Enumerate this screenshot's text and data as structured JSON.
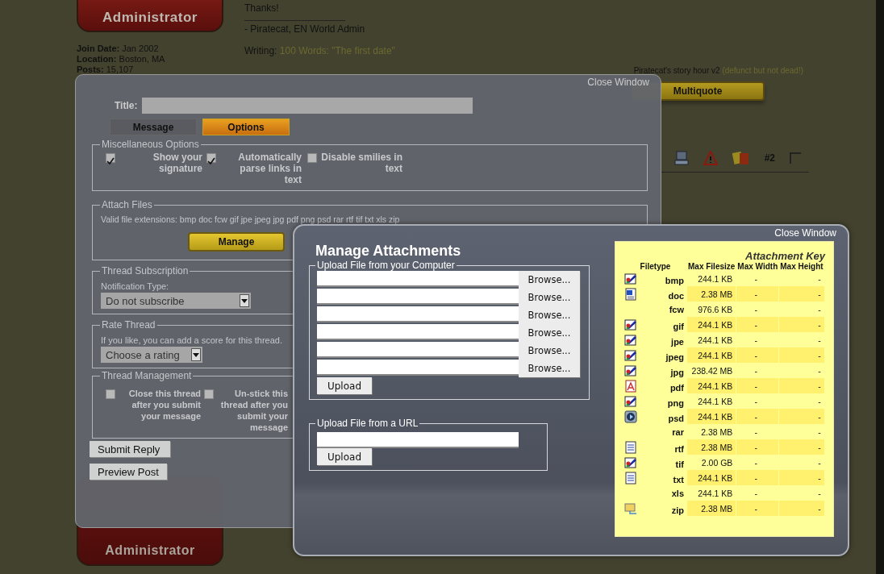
{
  "forum": {
    "top_post": {
      "rank_badge": "Administrator",
      "info": [
        {
          "label": "Join Date:",
          "value": "Jan 2002"
        },
        {
          "label": "Location:",
          "value": "Boston, MA"
        },
        {
          "label": "Posts:",
          "value": "15,107"
        }
      ],
      "message": "Thanks!",
      "signature": "- Piratecat, EN World Admin",
      "writing": {
        "label": "Writing:",
        "link": "100 Words: \"The first date\""
      },
      "story_link": "Piratecat's story hour v2",
      "story_note": "(defunct but not dead!)",
      "buttons": [
        "Multiquote"
      ]
    },
    "post_header": {
      "number": "#2"
    },
    "bottom_badge": "Administrator"
  },
  "options_dialog": {
    "close": "Close Window",
    "title_label": "Title:",
    "tabs": [
      {
        "label": "Message",
        "selected": false
      },
      {
        "label": "Options",
        "selected": true
      }
    ],
    "misc": {
      "legend": "Miscellaneous Options",
      "options": [
        {
          "label": "Show your signature",
          "checked": true
        },
        {
          "label": "Automatically parse links in text",
          "checked": true
        },
        {
          "label": "Disable smilies in text",
          "checked": false
        }
      ]
    },
    "attach": {
      "legend": "Attach Files",
      "extensions": "Valid file extensions: bmp doc fcw gif jpe jpeg jpg pdf png psd rar rtf tif txt xls zip",
      "button": "Manage"
    },
    "subscription": {
      "legend": "Thread Subscription",
      "label": "Notification Type:",
      "value": "Do not subscribe"
    },
    "rating": {
      "legend": "Rate Thread",
      "hint": "If you like, you can add a score for this thread.",
      "value": "Choose a rating"
    },
    "management": {
      "legend": "Thread Management",
      "options": [
        {
          "label": "Close this thread after you submit your message",
          "checked": false
        },
        {
          "label": "Un-stick this thread after you submit your message",
          "checked": false
        }
      ]
    },
    "buttons": [
      "Submit Reply",
      "Preview Post"
    ]
  },
  "attach_dialog": {
    "close": "Close Window",
    "title": "Manage Attachments",
    "computer": {
      "legend": "Upload File from your Computer",
      "browse": [
        "Browse...",
        "Browse...",
        "Browse...",
        "Browse...",
        "Browse...",
        "Browse..."
      ],
      "upload": "Upload"
    },
    "url": {
      "legend": "Upload File from a URL",
      "upload": "Upload"
    },
    "key": {
      "title": "Attachment Key",
      "columns": [
        "Filetype",
        "Max Filesize",
        "Max Width",
        "Max Height"
      ],
      "rows": [
        {
          "type": "bmp",
          "kind": "image",
          "size": "244.1 KB",
          "width": "-",
          "height": "-"
        },
        {
          "type": "doc",
          "kind": "word",
          "size": "2.38 MB",
          "width": "-",
          "height": "-"
        },
        {
          "type": "fcw",
          "kind": "none",
          "size": "976.6 KB",
          "width": "-",
          "height": "-"
        },
        {
          "type": "gif",
          "kind": "image",
          "size": "244.1 KB",
          "width": "-",
          "height": "-"
        },
        {
          "type": "jpe",
          "kind": "image",
          "size": "244.1 KB",
          "width": "-",
          "height": "-"
        },
        {
          "type": "jpeg",
          "kind": "image",
          "size": "244.1 KB",
          "width": "-",
          "height": "-"
        },
        {
          "type": "jpg",
          "kind": "image",
          "size": "238.42 MB",
          "width": "-",
          "height": "-"
        },
        {
          "type": "pdf",
          "kind": "pdf",
          "size": "244.1 KB",
          "width": "-",
          "height": "-"
        },
        {
          "type": "png",
          "kind": "image",
          "size": "244.1 KB",
          "width": "-",
          "height": "-"
        },
        {
          "type": "psd",
          "kind": "media",
          "size": "244.1 KB",
          "width": "-",
          "height": "-"
        },
        {
          "type": "rar",
          "kind": "none",
          "size": "2.38 MB",
          "width": "-",
          "height": "-"
        },
        {
          "type": "rtf",
          "kind": "text",
          "size": "2.38 MB",
          "width": "-",
          "height": "-"
        },
        {
          "type": "tif",
          "kind": "image",
          "size": "2.00 GB",
          "width": "-",
          "height": "-"
        },
        {
          "type": "txt",
          "kind": "text",
          "size": "244.1 KB",
          "width": "-",
          "height": "-"
        },
        {
          "type": "xls",
          "kind": "none",
          "size": "244.1 KB",
          "width": "-",
          "height": "-"
        },
        {
          "type": "zip",
          "kind": "network",
          "size": "2.38 MB",
          "width": "-",
          "height": "-"
        }
      ]
    }
  }
}
